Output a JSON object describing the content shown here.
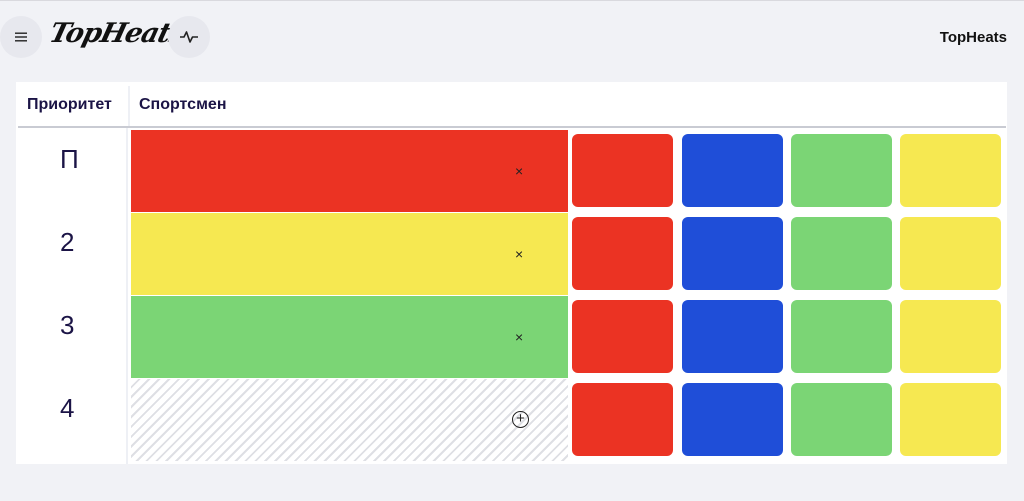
{
  "header": {
    "logo_text": "TopHeats",
    "title": "TopHeats",
    "menu_icon": "menu-icon",
    "activity_icon": "activity-icon"
  },
  "table": {
    "columns": {
      "priority": "Приоритет",
      "athlete": "Спортсмен"
    },
    "rows": [
      {
        "priority": "П",
        "athlete_color": "#eb3323",
        "action": "×"
      },
      {
        "priority": "2",
        "athlete_color": "#f6e851",
        "action": "×"
      },
      {
        "priority": "3",
        "athlete_color": "#7bd575",
        "action": "×"
      },
      {
        "priority": "4",
        "athlete_color": "empty",
        "action": "+"
      }
    ],
    "color_options": [
      {
        "name": "red",
        "color": "#eb3323"
      },
      {
        "name": "blue",
        "color": "#1f4ed8"
      },
      {
        "name": "green",
        "color": "#7bd575"
      },
      {
        "name": "yellow",
        "color": "#f6e851"
      }
    ]
  }
}
